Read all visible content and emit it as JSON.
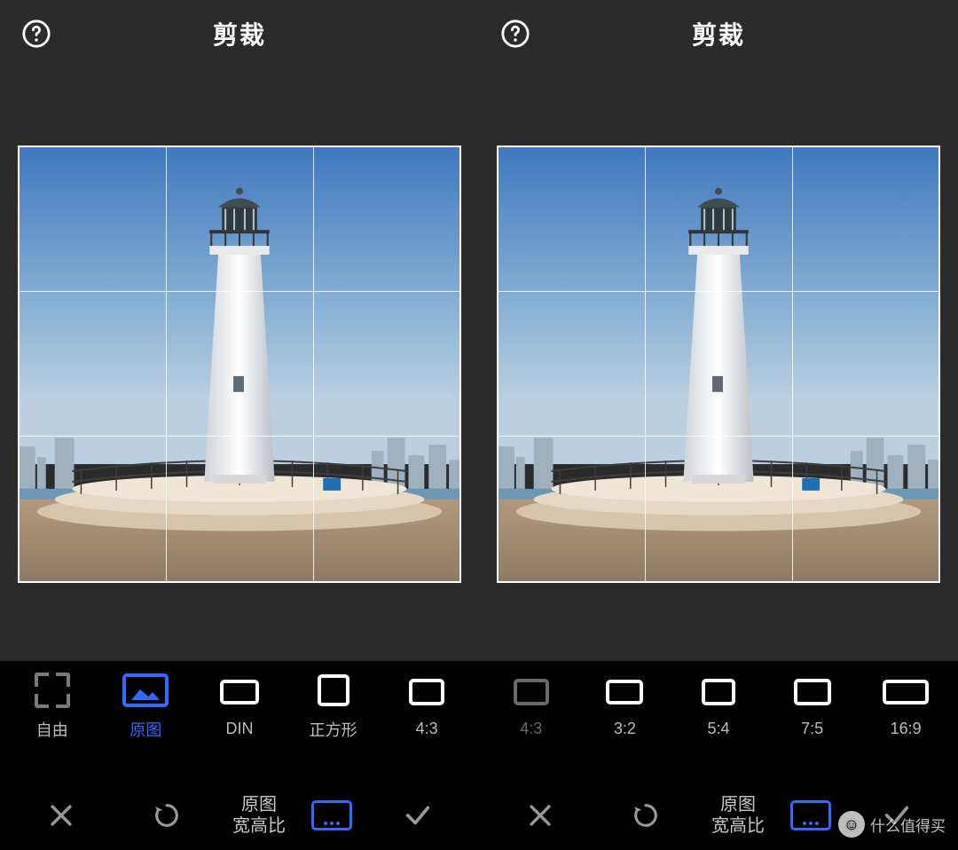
{
  "panes": [
    {
      "title": "剪裁",
      "help_icon": "help-circle-icon",
      "ratio_options": [
        {
          "name": "free",
          "label": "自由",
          "selected": false
        },
        {
          "name": "original",
          "label": "原图",
          "selected": true
        },
        {
          "name": "din",
          "label": "DIN",
          "selected": false
        },
        {
          "name": "square",
          "label": "正方形",
          "selected": false
        },
        {
          "name": "4_3",
          "label": "4:3",
          "selected": false
        }
      ],
      "toolbar": {
        "cancel": "close-icon",
        "rotate": "rotate-icon",
        "aspect_line1": "原图",
        "aspect_line2": "宽高比",
        "aspect_icon": "aspect-ratio-icon",
        "confirm": "check-icon"
      }
    },
    {
      "title": "剪裁",
      "help_icon": "help-circle-icon",
      "ratio_options": [
        {
          "name": "4_3",
          "label": "4:3",
          "selected": false,
          "dim": true
        },
        {
          "name": "3_2",
          "label": "3:2",
          "selected": false
        },
        {
          "name": "5_4",
          "label": "5:4",
          "selected": false
        },
        {
          "name": "7_5",
          "label": "7:5",
          "selected": false
        },
        {
          "name": "16_9",
          "label": "16:9",
          "selected": false
        }
      ],
      "toolbar": {
        "cancel": "close-icon",
        "rotate": "rotate-icon",
        "aspect_line1": "原图",
        "aspect_line2": "宽高比",
        "aspect_icon": "aspect-ratio-icon",
        "confirm": "check-icon"
      }
    }
  ],
  "watermark": "什么值得买"
}
